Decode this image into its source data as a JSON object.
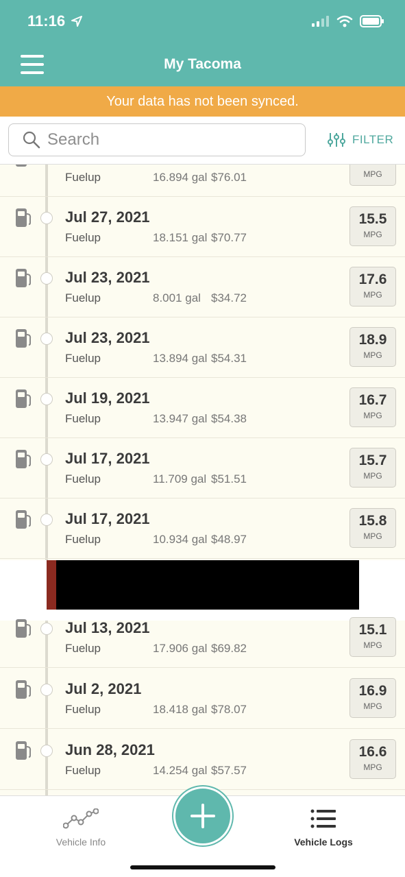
{
  "status": {
    "time": "11:16"
  },
  "header": {
    "title": "My Tacoma"
  },
  "banner": {
    "text": "Your data has not been synced."
  },
  "search": {
    "placeholder": "Search",
    "filter_label": "FILTER"
  },
  "partial_row": {
    "kind": "Fuelup",
    "gallons": "16.894 gal",
    "cost": "$76.01",
    "mpg_unit": "MPG"
  },
  "entries": [
    {
      "date": "Jul 27, 2021",
      "kind": "Fuelup",
      "gallons": "18.151 gal",
      "cost": "$70.77",
      "mpg": "15.5",
      "mpg_unit": "MPG"
    },
    {
      "date": "Jul 23, 2021",
      "kind": "Fuelup",
      "gallons": "8.001 gal",
      "cost": "$34.72",
      "mpg": "17.6",
      "mpg_unit": "MPG"
    },
    {
      "date": "Jul 23, 2021",
      "kind": "Fuelup",
      "gallons": "13.894 gal",
      "cost": "$54.31",
      "mpg": "18.9",
      "mpg_unit": "MPG"
    },
    {
      "date": "Jul 19, 2021",
      "kind": "Fuelup",
      "gallons": "13.947 gal",
      "cost": "$54.38",
      "mpg": "16.7",
      "mpg_unit": "MPG"
    },
    {
      "date": "Jul 17, 2021",
      "kind": "Fuelup",
      "gallons": "11.709 gal",
      "cost": "$51.51",
      "mpg": "15.7",
      "mpg_unit": "MPG"
    },
    {
      "date": "Jul 17, 2021",
      "kind": "Fuelup",
      "gallons": "10.934 gal",
      "cost": "$48.97",
      "mpg": "15.8",
      "mpg_unit": "MPG"
    },
    {
      "date": "Jul 13, 2021",
      "kind": "Fuelup",
      "gallons": "17.906 gal",
      "cost": "$69.82",
      "mpg": "15.1",
      "mpg_unit": "MPG"
    },
    {
      "date": "Jul 2, 2021",
      "kind": "Fuelup",
      "gallons": "18.418 gal",
      "cost": "$78.07",
      "mpg": "16.9",
      "mpg_unit": "MPG"
    },
    {
      "date": "Jun 28, 2021",
      "kind": "Fuelup",
      "gallons": "14.254 gal",
      "cost": "$57.57",
      "mpg": "16.6",
      "mpg_unit": "MPG"
    }
  ],
  "tabs": {
    "vehicle_info": "Vehicle Info",
    "vehicle_logs": "Vehicle Logs"
  },
  "colors": {
    "primary": "#5fb8ad",
    "banner": "#f0aa47",
    "background": "#fdfcf1"
  }
}
